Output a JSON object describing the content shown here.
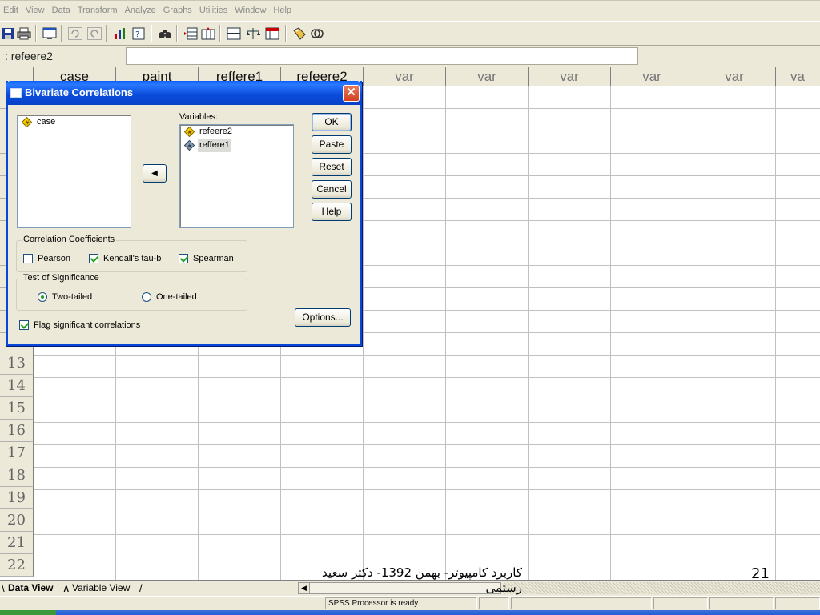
{
  "menu": {
    "items": [
      "Edit",
      "View",
      "Data",
      "Transform",
      "Analyze",
      "Graphs",
      "Utilities",
      "Window",
      "Help"
    ]
  },
  "cell_bar": {
    "reference": ": refeere2",
    "value": ""
  },
  "grid": {
    "columns": [
      "case",
      "paint",
      "reffere1",
      "refeere2",
      "var",
      "var",
      "var",
      "var",
      "var",
      "va"
    ],
    "rows": [
      "13",
      "14",
      "15",
      "16",
      "17",
      "18",
      "19",
      "20",
      "21",
      "22"
    ]
  },
  "dialog": {
    "title": "Bivariate Correlations",
    "close_label": "✕",
    "source_list": [
      {
        "label": "case",
        "icon": "scale-variable-icon"
      }
    ],
    "variables_label": "Variables:",
    "variables_list": [
      {
        "label": "refeere2",
        "icon": "scale-variable-icon"
      },
      {
        "label": "reffere1",
        "icon": "scale-variable-icon"
      }
    ],
    "move_button_glyph": "◀",
    "buttons": {
      "ok": "OK",
      "paste": "Paste",
      "reset": "Reset",
      "cancel": "Cancel",
      "help": "Help",
      "options": "Options..."
    },
    "correlation_coefficients": {
      "legend": "Correlation Coefficients",
      "pearson": {
        "label": "Pearson",
        "checked": false
      },
      "kendall": {
        "label": "Kendall's tau-b",
        "checked": true
      },
      "spearman": {
        "label": "Spearman",
        "checked": true
      }
    },
    "test_of_significance": {
      "legend": "Test of Significance",
      "two_tailed": {
        "label": "Two-tailed",
        "selected": true
      },
      "one_tailed": {
        "label": "One-tailed",
        "selected": false
      }
    },
    "flag_significant": {
      "label": "Flag significant correlations",
      "checked": true
    }
  },
  "tabs": {
    "data_view": "Data View",
    "variable_view": "Variable View"
  },
  "status": {
    "processor": "SPSS Processor  is ready"
  },
  "slide": {
    "footer_text": "کاربرد کامپیوتر- بهمن 1392- دکتر سعید رستمی",
    "page_number": "21"
  },
  "colors": {
    "title_bar": "#0a4bd9",
    "dialog_bg": "#ece9d8",
    "check_mark": "#21a121"
  }
}
